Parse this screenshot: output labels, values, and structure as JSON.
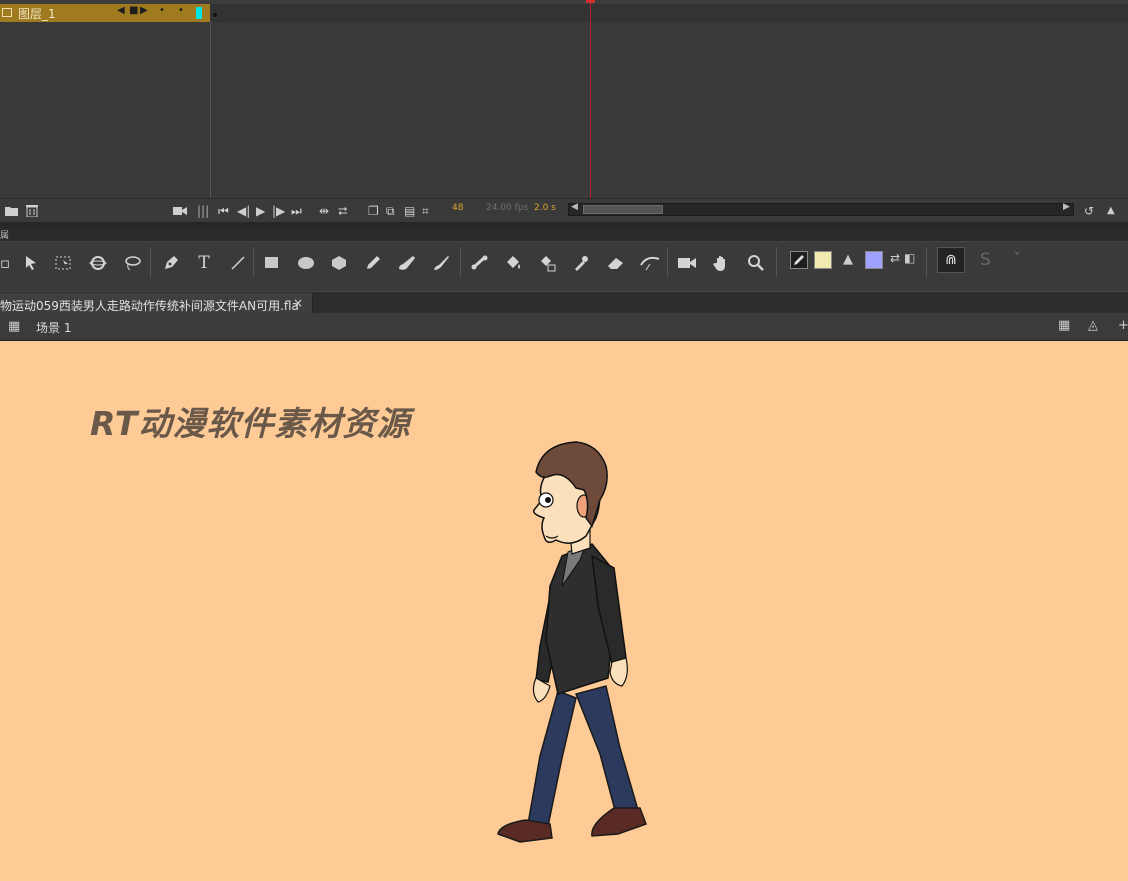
{
  "timeline": {
    "layer_name": "图层_1",
    "layer_controls": [
      "◀",
      "■",
      "▶",
      "•",
      "•"
    ],
    "frame_number": "48",
    "fps": "24.00 fps",
    "seconds": "2.0 s",
    "playback_controls": [
      "⏮",
      "◀|",
      "▶",
      "|▶",
      "⏭"
    ]
  },
  "panel_tab": "属",
  "tools": {
    "icons": [
      "selection-tool",
      "free-transform-tool",
      "3d-rotation-tool",
      "lasso-tool",
      "pen-tool",
      "text-tool",
      "line-tool",
      "rectangle-tool",
      "oval-tool",
      "polystar-tool",
      "pencil-tool",
      "paint-brush-tool",
      "brush-tool",
      "bone-tool",
      "paint-bucket-tool",
      "ink-bottle-tool",
      "eyedropper-tool",
      "eraser-tool",
      "width-tool",
      "camera-tool",
      "hand-tool",
      "zoom-tool"
    ],
    "text_tool_label": "T",
    "stroke_color": "#f0eab0",
    "fill_color": "#a0a0ff"
  },
  "document": {
    "tab_title": "物运动059西装男人走路动作传统补间源文件AN可用.fla",
    "close_label": "×"
  },
  "scene": {
    "label": "场景 1"
  },
  "stage": {
    "background_color": "#fecb97",
    "watermark_text": "RT动漫软件素材资源"
  }
}
